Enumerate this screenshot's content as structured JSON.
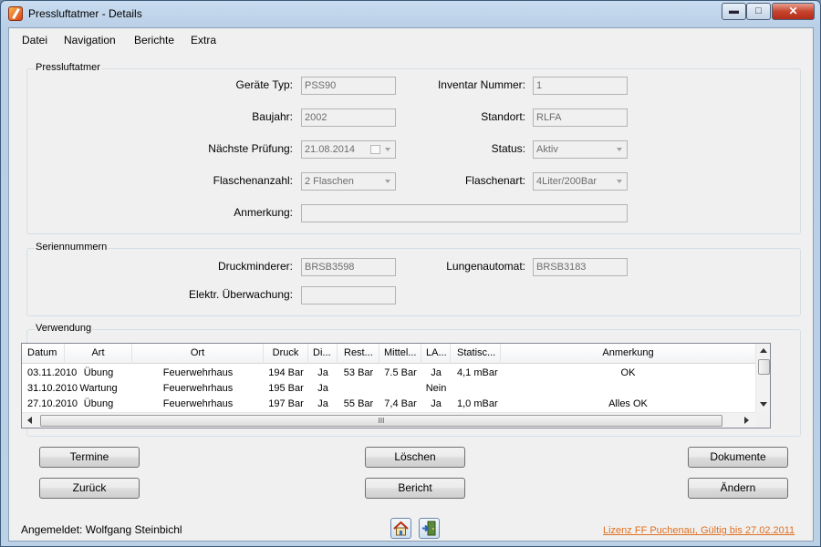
{
  "window": {
    "title": "Pressluftatmer - Details",
    "min_glyph": "▬",
    "max_glyph": "□",
    "close_glyph": "✕"
  },
  "menu": [
    "Datei",
    "Navigation",
    "Berichte",
    "Extra"
  ],
  "pressluftatmer": {
    "legend": "Pressluftatmer",
    "geraete_typ": {
      "label": "Geräte Typ:",
      "value": "PSS90"
    },
    "inventar_nummer": {
      "label": "Inventar Nummer:",
      "value": "1"
    },
    "baujahr": {
      "label": "Baujahr:",
      "value": "2002"
    },
    "standort": {
      "label": "Standort:",
      "value": "RLFA"
    },
    "naechste_pruefung": {
      "label": "Nächste Prüfung:",
      "value": "21.08.2014"
    },
    "status": {
      "label": "Status:",
      "value": "Aktiv"
    },
    "flaschenanzahl": {
      "label": "Flaschenanzahl:",
      "value": "2 Flaschen"
    },
    "flaschenart": {
      "label": "Flaschenart:",
      "value": "4Liter/200Bar"
    },
    "anmerkung": {
      "label": "Anmerkung:",
      "value": ""
    }
  },
  "seriennummern": {
    "legend": "Seriennummern",
    "druckminderer": {
      "label": "Druckminderer:",
      "value": "BRSB3598"
    },
    "lungenautomat": {
      "label": "Lungenautomat:",
      "value": "BRSB3183"
    },
    "elektr_ueberwachung": {
      "label": "Elektr. Überwachung:",
      "value": ""
    }
  },
  "verwendung": {
    "legend": "Verwendung",
    "columns": [
      "Datum",
      "Art",
      "Ort",
      "Druck",
      "Di...",
      "Rest...",
      "Mittel...",
      "LA...",
      "Statisc...",
      "Anmerkung"
    ],
    "rows": [
      [
        "03.11.2010",
        "Übung",
        "Feuerwehrhaus",
        "194 Bar",
        "Ja",
        "53 Bar",
        "7.5 Bar",
        "Ja",
        "4,1 mBar",
        "OK"
      ],
      [
        "31.10.2010",
        "Wartung",
        "Feuerwehrhaus",
        "195 Bar",
        "Ja",
        "",
        "",
        "Nein",
        "",
        ""
      ],
      [
        "27.10.2010",
        "Übung",
        "Feuerwehrhaus",
        "197 Bar",
        "Ja",
        "55 Bar",
        "7,4 Bar",
        "Ja",
        "1,0 mBar",
        "Alles OK"
      ]
    ],
    "hscroll_grip": "III"
  },
  "buttons": {
    "termine": "Termine",
    "loeschen": "Löschen",
    "dokumente": "Dokumente",
    "zurueck": "Zurück",
    "bericht": "Bericht",
    "aendern": "Ändern"
  },
  "status": {
    "angemeldet": "Angemeldet: Wolfgang Steinbichl",
    "lizenz": "Lizenz FF Puchenau, Gültig bis 27.02.2011"
  },
  "icons": {
    "home": "home-icon",
    "exit": "exit-door-icon"
  },
  "colors": {
    "link": "#e07020",
    "title_bar": "#c9dcf0",
    "client": "#f0f0f0"
  }
}
